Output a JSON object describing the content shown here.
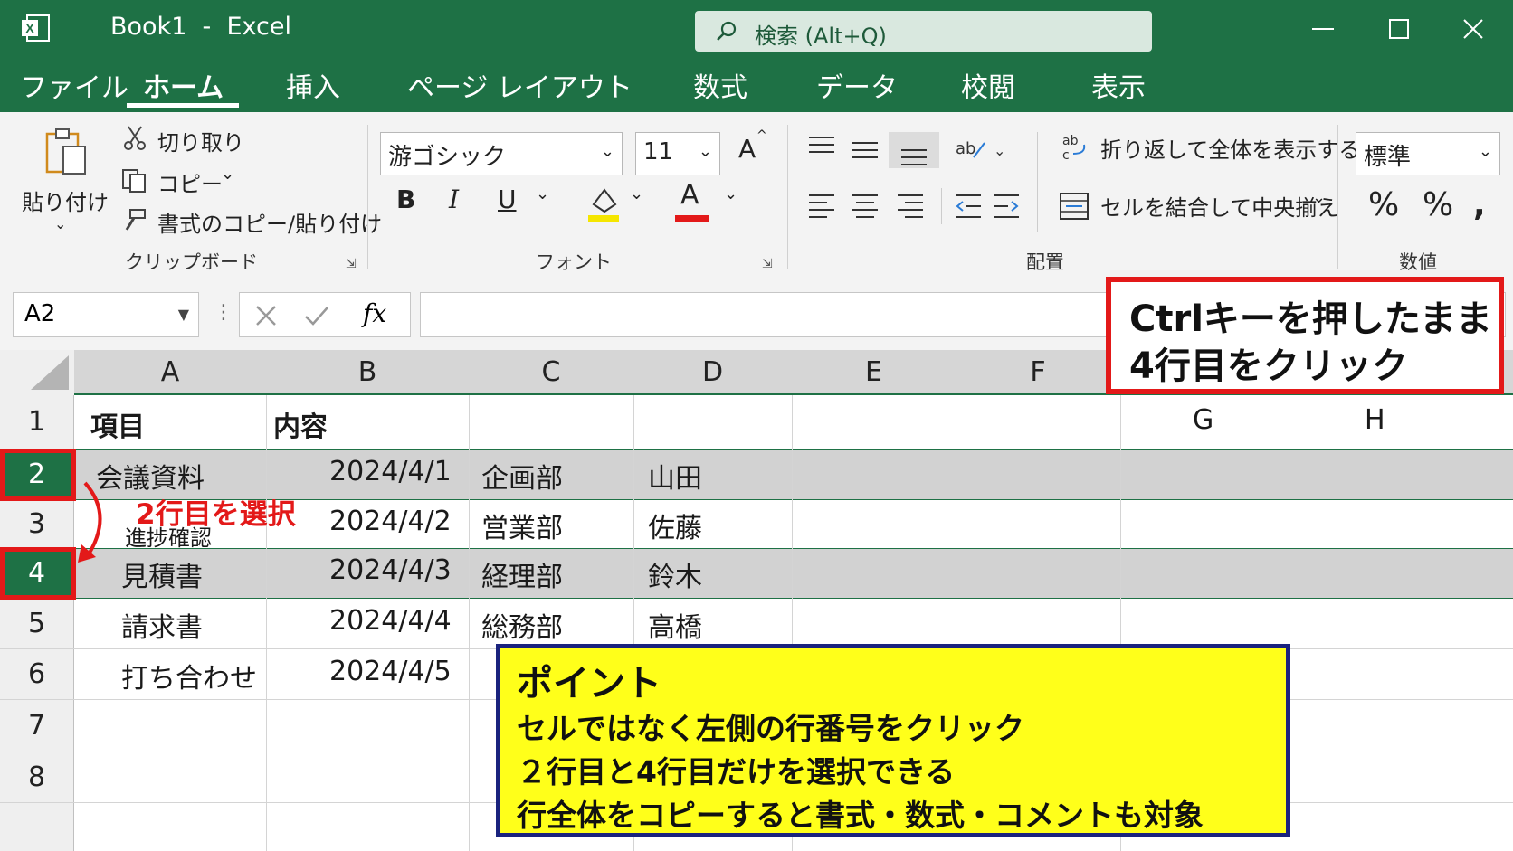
{
  "window": {
    "title": "Book1  -  Excel",
    "search_placeholder": "検索 (Alt+Q)"
  },
  "tabs": [
    "ファイル",
    "ホーム",
    "挿入",
    "ページ レイアウト",
    "数式",
    "データ",
    "校閲",
    "表示"
  ],
  "active_tab": "ホーム",
  "ribbon": {
    "clipboard": {
      "paste": "貼り付け",
      "cut": "切り取り",
      "copy": "コピー",
      "format_painter": "書式のコピー/貼り付け",
      "label": "クリップボード"
    },
    "font": {
      "name": "游ゴシック",
      "size": "11",
      "bold": "B",
      "italic": "I",
      "underline": "U",
      "font_color": "A",
      "grow": "A",
      "label": "フォント",
      "highlight_color": "#f5e600",
      "font_color_bar": "#e31919"
    },
    "alignment": {
      "wrap_text": "折り返して全体を表示する",
      "merge_center": "セルを結合して中央揃え",
      "label": "配置"
    },
    "number": {
      "format": "標準",
      "percent": "%",
      "comma": ",",
      "label": "数値"
    }
  },
  "formula_bar": {
    "name_box": "A2",
    "fx": "fx",
    "value": ""
  },
  "grid": {
    "columns": [
      "A",
      "B",
      "C",
      "D",
      "E",
      "F"
    ],
    "columns_offset": [
      "G",
      "H"
    ],
    "row_numbers": [
      "1",
      "2",
      "3",
      "4",
      "5",
      "6",
      "7",
      "8"
    ],
    "rows": [
      {
        "a": "項目",
        "b": "内容",
        "c": "",
        "d": ""
      },
      {
        "a": "会議資料",
        "b": "2024/4/1",
        "c": "企画部",
        "d": "山田"
      },
      {
        "a": "進捗確認",
        "b": "2024/4/2",
        "c": "営業部",
        "d": "佐藤"
      },
      {
        "a": "見積書",
        "b": "2024/4/3",
        "c": "経理部",
        "d": "鈴木"
      },
      {
        "a": "請求書",
        "b": "2024/4/4",
        "c": "総務部",
        "d": "高橋"
      },
      {
        "a": "打ち合わせ",
        "b": "2024/4/5",
        "c": "",
        "d": ""
      }
    ],
    "selected_rows": [
      "2",
      "4"
    ]
  },
  "annotations": {
    "ctrl_line1": "Ctrlキーを押したまま",
    "ctrl_line2": "4行目をクリック",
    "row2_label": "2行目を選択",
    "point_title": "ポイント",
    "point_lines": [
      "セルではなく左側の行番号をクリック",
      "２行目と4行目だけを選択できる",
      "行全体をコピーすると書式・数式・コメントも対象"
    ],
    "accent_red": "#e31919",
    "point_bg": "#ffff1a"
  }
}
